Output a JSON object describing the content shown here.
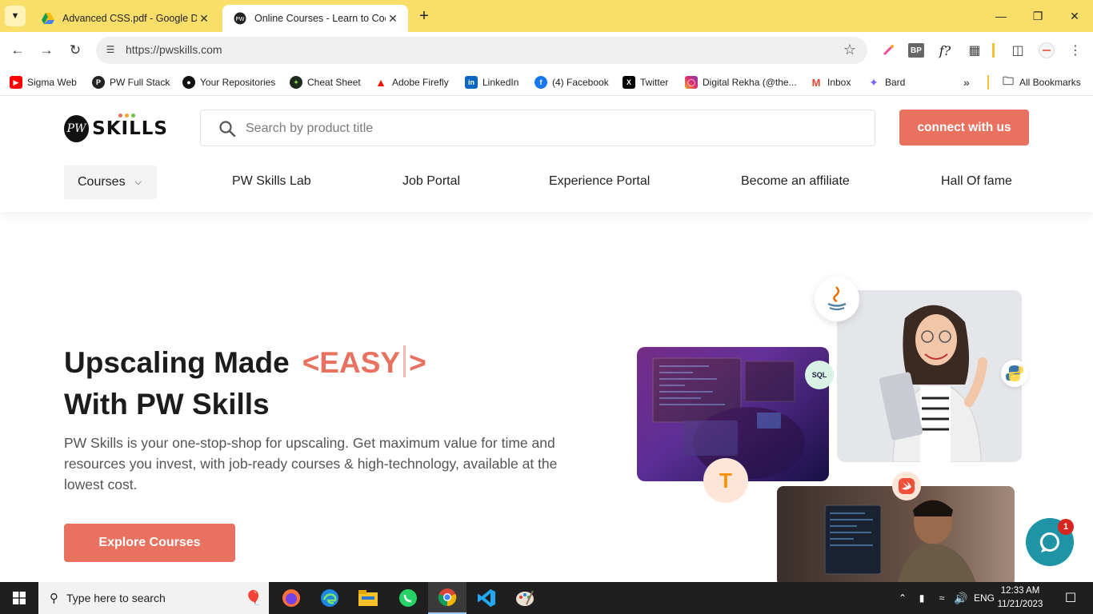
{
  "browser": {
    "tabs": [
      {
        "title": "Advanced CSS.pdf - Google Drive",
        "icon": "google-drive-icon",
        "active": false
      },
      {
        "title": "Online Courses - Learn to Code",
        "icon": "pwskills-icon",
        "active": true
      }
    ],
    "url": "https://pwskills.com",
    "bookmarks": [
      {
        "label": "Sigma Web",
        "icon": "youtube-icon"
      },
      {
        "label": "PW Full Stack",
        "icon": "pwskills-icon"
      },
      {
        "label": "Your Repositories",
        "icon": "github-icon"
      },
      {
        "label": "Cheat Sheet",
        "icon": "cheatsheet-icon"
      },
      {
        "label": "Adobe Firefly",
        "icon": "adobe-icon"
      },
      {
        "label": "LinkedIn",
        "icon": "linkedin-icon"
      },
      {
        "label": "(4) Facebook",
        "icon": "facebook-icon"
      },
      {
        "label": "Twitter",
        "icon": "x-icon"
      },
      {
        "label": "Digital Rekha (@the...",
        "icon": "instagram-icon"
      },
      {
        "label": "Inbox",
        "icon": "gmail-icon"
      },
      {
        "label": "Bard",
        "icon": "bard-icon"
      }
    ],
    "all_bookmarks": "All Bookmarks",
    "extensions": {
      "bp_label": "BP",
      "fx_label": "f?"
    }
  },
  "page": {
    "logo_text": "SKILLS",
    "logo_mark": "PW",
    "search_placeholder": "Search by product title",
    "connect_label": "connect with us",
    "nav": {
      "courses": "Courses",
      "links": [
        "PW Skills Lab",
        "Job Portal",
        "Experience Portal",
        "Become an affiliate",
        "Hall Of fame"
      ]
    },
    "hero": {
      "title_line1": "Upscaling Made",
      "title_highlight_open": "<EASY",
      "title_highlight_close": ">",
      "title_line2": "With PW Skills",
      "description": "PW Skills is your one-stop-shop for upscaling. Get maximum value for time and resources you invest, with job-ready courses & high-technology, available at the lowest cost.",
      "cta": "Explore Courses"
    },
    "badges": {
      "sql": "SQL",
      "tensorflow": "T"
    },
    "chat": {
      "unread_count": "1"
    }
  },
  "taskbar": {
    "search_placeholder": "Type here to search",
    "language": "ENG",
    "time": "12:33 AM",
    "date": "11/21/2023"
  },
  "colors": {
    "brand": "#e8725f",
    "tab_strip": "#f9df6a",
    "chat": "#1f94a6"
  }
}
